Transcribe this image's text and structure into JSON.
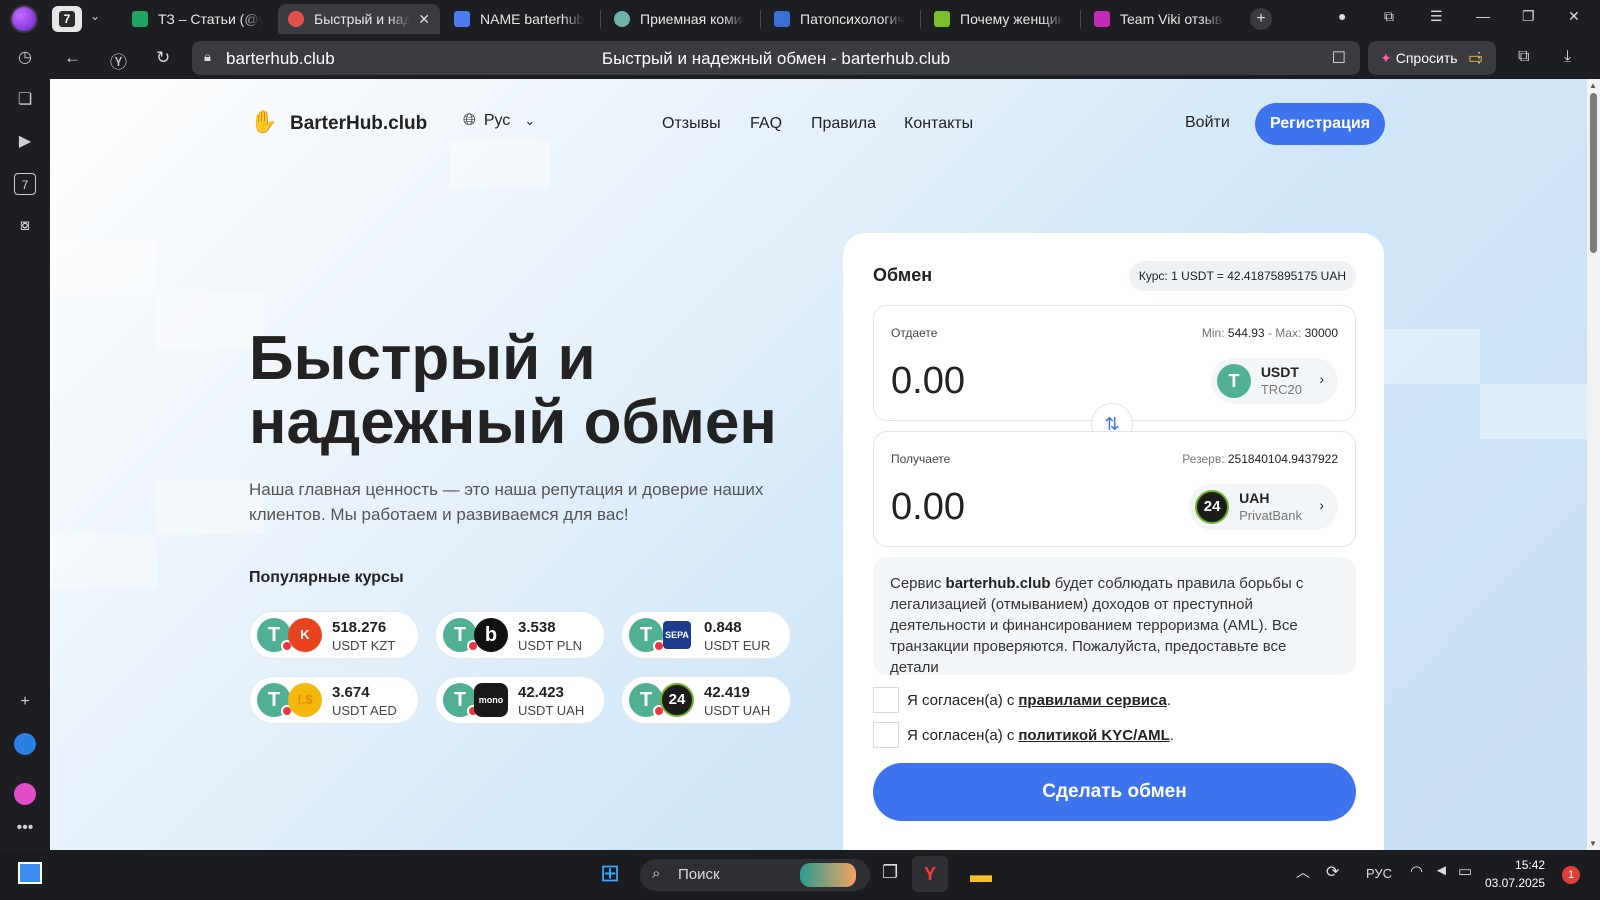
{
  "browser": {
    "tab_count": "7",
    "tabs": [
      {
        "title": "ТЗ – Статьи (@ya",
        "icon_color": "#1fa463"
      },
      {
        "title": "Быстрый и над",
        "icon_color": "#e2504b"
      },
      {
        "title": "NAME barterhub -",
        "icon_color": "#4a7cf0"
      },
      {
        "title": "Приемная комисс",
        "icon_color": "#6fb3a8"
      },
      {
        "title": "Патопсихологиче",
        "icon_color": "#3b6fd8"
      },
      {
        "title": "Почему женщины",
        "icon_color": "#7bbf2a"
      },
      {
        "title": "Team Viki отзывы",
        "icon_color": "#c12bb7"
      }
    ],
    "url_domain": "barterhub.club",
    "page_title": "Быстрый и надежный обмен - barterhub.club",
    "ask_label": "Спросить"
  },
  "site": {
    "logo_text": "BarterHub.club",
    "lang": "Рус",
    "nav": [
      "Отзывы",
      "FAQ",
      "Правила",
      "Контакты"
    ],
    "login": "Войти",
    "register": "Регистрация",
    "hero_title": "Быстрый и надежный обмен",
    "hero_sub": "Наша главная ценность — это наша репутация и доверие наших клиентов. Мы работаем и развиваемся для вас!",
    "popular_title": "Популярные курсы",
    "rates": [
      {
        "value": "518.276",
        "pair": "USDT KZT",
        "icon2": "K",
        "icon2_color": "#e8431f"
      },
      {
        "value": "3.538",
        "pair": "USDT PLN",
        "icon2": "b",
        "icon2_color": "#111111"
      },
      {
        "value": "0.848",
        "pair": "USDT EUR",
        "icon2": "SEPA",
        "icon2_color": "#1d3c8f"
      },
      {
        "value": "3.674",
        "pair": "USDT AED",
        "icon2": "!.$",
        "icon2_color": "#f5b80e"
      },
      {
        "value": "42.423",
        "pair": "USDT UAH",
        "icon2": "mono",
        "icon2_color": "#1a1a1a"
      },
      {
        "value": "42.419",
        "pair": "USDT UAH",
        "icon2": "24",
        "icon2_color": "#1c1c1c"
      }
    ]
  },
  "exchange": {
    "title": "Обмен",
    "rate": "Курс: 1 USDT = 42.41875895175 UAH",
    "give_label": "Отдаете",
    "give_minmax_min_label": "Min:",
    "give_min": "544.93",
    "give_minmax_sep": "- Max:",
    "give_max": "30000",
    "give_amount": "0.00",
    "give_currency": "USDT",
    "give_network": "TRC20",
    "get_label": "Получаете",
    "reserve_label": "Резерв:",
    "reserve_value": "251840104.9437922",
    "get_amount": "0.00",
    "get_currency": "UAH",
    "get_network": "PrivatBank",
    "aml_prefix": "Сервис",
    "aml_domain": "barterhub.club",
    "aml_text": "будет соблюдать правила борьбы с легализацией (отмыванием) доходов от преступной деятельности и финансированием терроризма (AML). Все транзакции проверяются. Пожалуйста, предоставьте все детали",
    "agree1_text": "Я согласен(а) с",
    "agree1_link": "правилами сервиса",
    "agree2_text": "Я согласен(а) с",
    "agree2_link": "политикой KYC/AML",
    "submit": "Сделать обмен"
  },
  "taskbar": {
    "search": "Поиск",
    "lang": "РУС",
    "time": "15:42",
    "date": "03.07.2025",
    "notif": "1"
  },
  "colors": {
    "accent": "#3d74ee",
    "tether": "#50af95"
  }
}
